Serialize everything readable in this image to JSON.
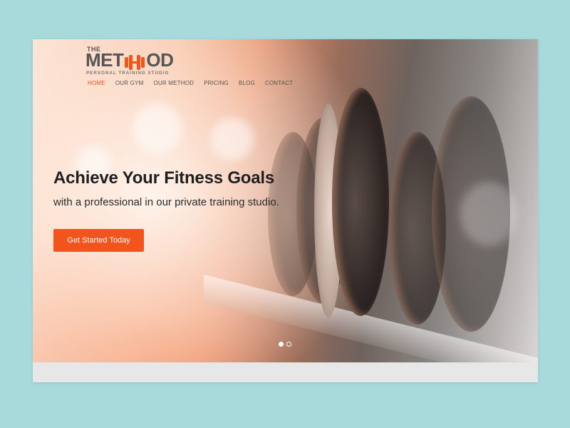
{
  "brand": {
    "the": "THE",
    "word_left": "MET",
    "word_right": "OD",
    "tagline": "PERSONAL TRAINING STUDIO",
    "accent": "#f2541b",
    "logo_icon": "dumbbell-icon"
  },
  "nav": {
    "items": [
      {
        "label": "HOME",
        "active": true
      },
      {
        "label": "OUR GYM",
        "active": false
      },
      {
        "label": "OUR METHOD",
        "active": false
      },
      {
        "label": "PRICING",
        "active": false
      },
      {
        "label": "BLOG",
        "active": false
      },
      {
        "label": "CONTACT",
        "active": false
      }
    ]
  },
  "hero": {
    "headline": "Achieve Your Fitness Goals",
    "subheadline": "with a professional in our private training studio.",
    "cta_label": "Get Started Today",
    "slides_total": 2,
    "slide_active": 1
  },
  "colors": {
    "page_background": "#a8dadb",
    "button": "#f2541b",
    "footer_bar": "#e7e7e7"
  }
}
